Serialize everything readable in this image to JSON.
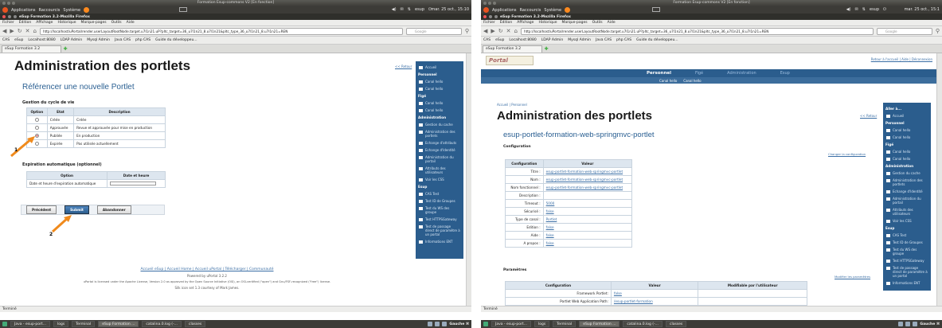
{
  "gnome": {
    "apps": "Applications",
    "places": "Raccourcis",
    "system": "Système",
    "user": "esup",
    "clock_a": "mar. 25 oct., 15:10",
    "clock_b": "mar. 25 oct., 15:1"
  },
  "window_title": "Formation Esup-commons V2 [En fonction]",
  "firefox_title": "eSup Formation 3.2-Mozilla Firefox",
  "menu": [
    "Fichier",
    "Édition",
    "Affichage",
    "Historique",
    "Marque-pages",
    "Outils",
    "Aide"
  ],
  "url_a": "http://localhost/uPortal/render.userLayoutRootNode.target.u7l1n21.uP?pltc_target=36_u7l1n21_8.u7l1n21&pltc_type_36_u7l1n21_8.u7l1n21=REN",
  "url_b": "http://localhost/uPortal/render.userLayoutRootNode.target.u7l1n21.uP?pltc_target=36_u7l1n21_8.u7l1n21&pltc_type_36_u7l1n21_8.u7l1n21=REN",
  "search_placeholder": "Google",
  "bookmarks": [
    "CAS",
    "eSup",
    "Localhost:8080",
    "LDAP Admin",
    "Mysql Admin",
    "Java CAS",
    "php CAS",
    "Guide du développeu..."
  ],
  "tab_label": "eSup Formation 3.2",
  "status": "Terminé",
  "taskbar_a": [
    "Java - esup-port...",
    "logs",
    "Terminal",
    "eSup Formation ...",
    "catalina.0.log (-...",
    "classes"
  ],
  "taskbar_b": [
    "Java - esup-port...",
    "logs",
    "Terminal",
    "eSup Formation ...",
    "catalina.0.log (-...",
    "classes"
  ],
  "taskbar_right": "Gauche ⌘",
  "a": {
    "title": "Administration des portlets",
    "subtitle": "Référencer une nouvelle Portlet",
    "return": "<< Retour",
    "lifecycle": "Gestion du cycle de vie",
    "lc_headers": [
      "Option",
      "Etat",
      "Description"
    ],
    "lc_rows": [
      [
        "Créée",
        "Créée"
      ],
      [
        "Approuvée",
        "Revue et approuvée pour mise en production"
      ],
      [
        "Publiée",
        "En production"
      ],
      [
        "Expirée",
        "Pas utilisée actuellement"
      ]
    ],
    "expiration": "Expiration automatique (optionnel)",
    "exp_headers": [
      "Option",
      "Date et heure"
    ],
    "exp_label": "Date et heure d'expiration automatique",
    "btn_prev": "Précédent",
    "btn_submit": "Submit",
    "btn_cancel": "Abandonner",
    "marker1": "1",
    "marker2": "2",
    "footer_links": "Accueil eSup | Accueil Home | Accueil uPortal | Télécharger | Communauté",
    "footer_powered": "Powered by uPortal 3.2.2",
    "footer_license": "uPortal is licensed under the Apache License, Version 2.0 as approved by the Open Source Initiative (OSI), an OSI-certified (\"open\") and Gnu/FSF-recognized (\"free\") license.",
    "footer_skin": "Silk icon set 1.3 courtesy of Mark James."
  },
  "sidebar_a": [
    {
      "type": "item",
      "label": "Accueil"
    },
    {
      "type": "hd",
      "label": "Personnel"
    },
    {
      "type": "item",
      "label": "Canal hello"
    },
    {
      "type": "item",
      "label": "Canal hello"
    },
    {
      "type": "hd",
      "label": "Figé"
    },
    {
      "type": "item",
      "label": "Canal hello"
    },
    {
      "type": "item",
      "label": "Canal hello"
    },
    {
      "type": "hd",
      "label": "Administration"
    },
    {
      "type": "item",
      "label": "Gestion du cache"
    },
    {
      "type": "item",
      "label": "Administration des portlets"
    },
    {
      "type": "item",
      "label": "Echange d'attributs"
    },
    {
      "type": "item",
      "label": "Echange d'Identité"
    },
    {
      "type": "item",
      "label": "Administration du portail"
    },
    {
      "type": "item",
      "label": "Attributs des utilisateurs"
    },
    {
      "type": "item",
      "label": "Voir les CSS"
    },
    {
      "type": "hd",
      "label": "Esup"
    },
    {
      "type": "item",
      "label": "CAS Test"
    },
    {
      "type": "item",
      "label": "Test ID de Groupes"
    },
    {
      "type": "item",
      "label": "Test du WS des groupe"
    },
    {
      "type": "item",
      "label": "Test HTTPSGateway"
    },
    {
      "type": "item",
      "label": "Test de passage direct de paramètre à un portal"
    },
    {
      "type": "item",
      "label": "Informations ENT"
    }
  ],
  "b": {
    "logo": "Portal",
    "toplinks": "Retour à l'accueil  |  Aide  |  Déconnexion",
    "tabs": [
      "Personnel",
      "Figé",
      "Administration",
      "Esup"
    ],
    "subtabs": [
      "Canal hello",
      "Canal hello"
    ],
    "breadcrumb": "Accueil  |  Personnel",
    "title": "Administration des portlets",
    "return": "<< Retour",
    "subtitle": "esup-portlet-formation-web-springmvc-portlet",
    "config": "Configuration",
    "change_config": "Changer la configuration",
    "cfg_headers": [
      "Configuration",
      "Valeur"
    ],
    "cfg_rows": [
      [
        "Titre :",
        "esup-portlet-formation-web-springmvc-portlet"
      ],
      [
        "Nom :",
        "esup-portlet-formation-web-springmvc-portlet"
      ],
      [
        "Nom fonctionnel :",
        "esup-portlet-formation-web-springmvc-portlet"
      ],
      [
        "Description :",
        ""
      ],
      [
        "Timeout :",
        "5000"
      ],
      [
        "Sécurisé :",
        "false"
      ],
      [
        "Type de canal :",
        "Portlet"
      ],
      [
        "Edition :",
        "false"
      ],
      [
        "Aide :",
        "false"
      ],
      [
        "A propos :",
        "false"
      ]
    ],
    "params": "Paramètres",
    "change_params": "Modifier les paramètres",
    "par_headers": [
      "Configuration",
      "Valeur",
      "Modifiable par l'utilisateur"
    ],
    "par_rows": [
      [
        "Framework Portlet:",
        "false"
      ],
      [
        "Portlet Web Application Path:",
        "/esup-portlet-formation"
      ]
    ],
    "go_to": "Aller à..."
  },
  "sidebar_b": [
    {
      "type": "item",
      "label": "Accueil"
    },
    {
      "type": "hd",
      "label": "Personnel"
    },
    {
      "type": "item",
      "label": "Canal hello"
    },
    {
      "type": "item",
      "label": "Canal hello"
    },
    {
      "type": "hd",
      "label": "Figé"
    },
    {
      "type": "item",
      "label": "Canal hello"
    },
    {
      "type": "item",
      "label": "Canal hello"
    },
    {
      "type": "hd",
      "label": "Administration"
    },
    {
      "type": "item",
      "label": "Gestion du cache"
    },
    {
      "type": "item",
      "label": "Administration des portlets"
    },
    {
      "type": "item",
      "label": "Echange d'Identité"
    },
    {
      "type": "item",
      "label": "Administration du portail"
    },
    {
      "type": "item",
      "label": "Attributs des utilisateurs"
    },
    {
      "type": "item",
      "label": "Voir les CSS"
    },
    {
      "type": "hd",
      "label": "Esup"
    },
    {
      "type": "item",
      "label": "CAS Test"
    },
    {
      "type": "item",
      "label": "Test ID de Groupes"
    },
    {
      "type": "item",
      "label": "Test du WS des groupe"
    },
    {
      "type": "item",
      "label": "Test HTTPSGateway"
    },
    {
      "type": "item",
      "label": "Test de passage direct de paramètre à un portal"
    },
    {
      "type": "item",
      "label": "Informations ENT"
    }
  ]
}
